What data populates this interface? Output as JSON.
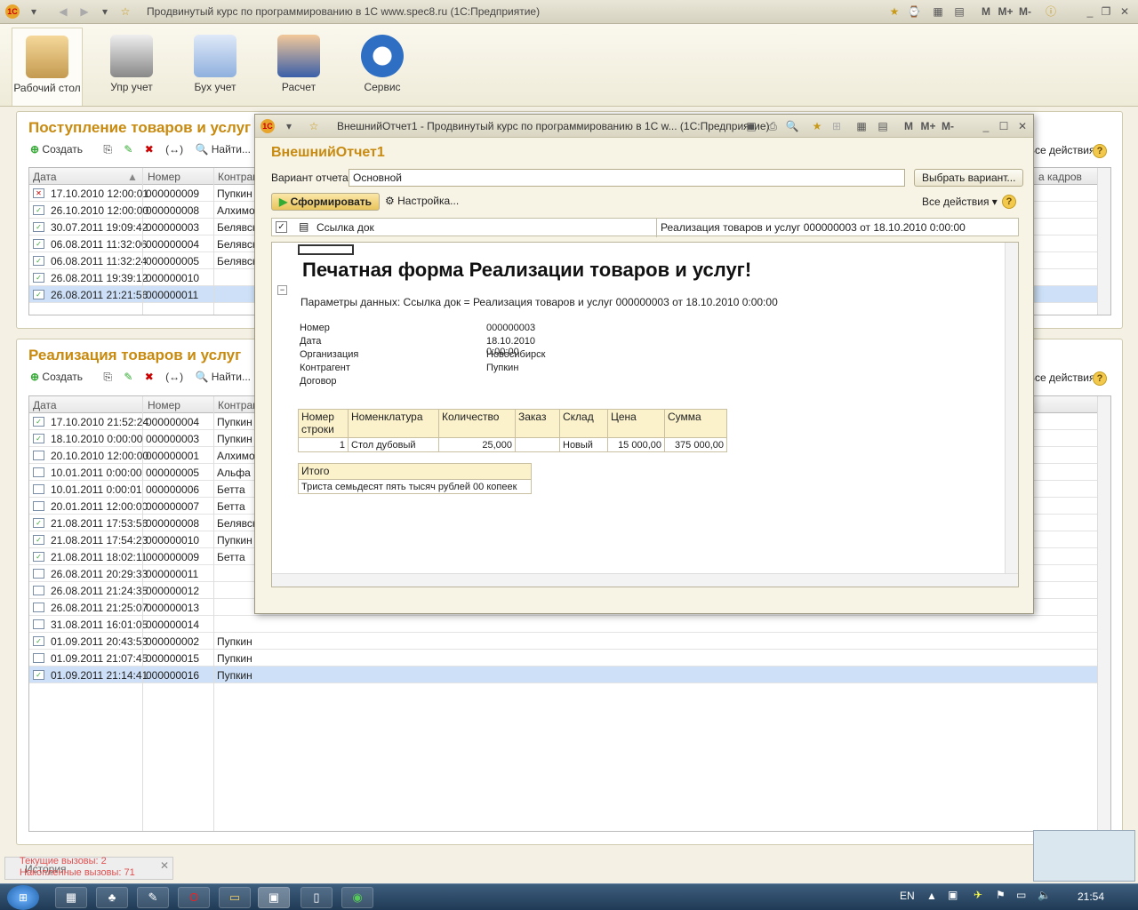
{
  "app": {
    "title": "Продвинутый курс по программированию в 1С www.spec8.ru  (1С:Предприятие)",
    "quick_buttons": [
      "M",
      "M+",
      "M-"
    ]
  },
  "sections": [
    {
      "label": "Рабочий стол"
    },
    {
      "label": "Упр учет"
    },
    {
      "label": "Бух учет"
    },
    {
      "label": "Расчет"
    },
    {
      "label": "Сервис"
    }
  ],
  "receipts": {
    "title": "Поступление товаров и услуг",
    "toolbar": {
      "create": "Создать",
      "find": "Найти...",
      "all_actions": "Все действия",
      "extra_col": "а кадров"
    },
    "columns": [
      "Дата",
      "Номер",
      "Контраг"
    ],
    "rows": [
      {
        "date": "17.10.2010 12:00:01",
        "num": "000000009",
        "agent": "Пупкин",
        "mark": "x"
      },
      {
        "date": "26.10.2010 12:00:00",
        "num": "000000008",
        "agent": "Алхимов",
        "mark": "ok"
      },
      {
        "date": "30.07.2011 19:09:42",
        "num": "000000003",
        "agent": "Белявск",
        "mark": "ok"
      },
      {
        "date": "06.08.2011 11:32:06",
        "num": "000000004",
        "agent": "Белявск",
        "mark": "ok"
      },
      {
        "date": "06.08.2011 11:32:24",
        "num": "000000005",
        "agent": "Белявск",
        "mark": "ok"
      },
      {
        "date": "26.08.2011 19:39:12",
        "num": "000000010",
        "agent": "",
        "mark": "ok"
      },
      {
        "date": "26.08.2011 21:21:56",
        "num": "000000011",
        "agent": "",
        "mark": "ok"
      }
    ]
  },
  "sales": {
    "title": "Реализация товаров и услуг",
    "toolbar": {
      "create": "Создать",
      "find": "Найти...",
      "all_actions": "Все действия"
    },
    "columns": [
      "Дата",
      "Номер",
      "Контраг"
    ],
    "rows": [
      {
        "date": "17.10.2010 21:52:24",
        "num": "000000004",
        "agent": "Пупкин",
        "mark": "ok"
      },
      {
        "date": "18.10.2010 0:00:00",
        "num": "000000003",
        "agent": "Пупкин",
        "mark": "ok"
      },
      {
        "date": "20.10.2010 12:00:00",
        "num": "000000001",
        "agent": "Алхимов",
        "mark": ""
      },
      {
        "date": "10.01.2011 0:00:00",
        "num": "000000005",
        "agent": "Альфа",
        "mark": ""
      },
      {
        "date": "10.01.2011 0:00:01",
        "num": "000000006",
        "agent": "Бетта",
        "mark": ""
      },
      {
        "date": "20.01.2011 12:00:00",
        "num": "000000007",
        "agent": "Бетта",
        "mark": ""
      },
      {
        "date": "21.08.2011 17:53:56",
        "num": "000000008",
        "agent": "Белявск",
        "mark": "ok"
      },
      {
        "date": "21.08.2011 17:54:23",
        "num": "000000010",
        "agent": "Пупкин",
        "mark": "ok"
      },
      {
        "date": "21.08.2011 18:02:11",
        "num": "000000009",
        "agent": "Бетта",
        "mark": "ok"
      },
      {
        "date": "26.08.2011 20:29:33",
        "num": "000000011",
        "agent": "",
        "mark": ""
      },
      {
        "date": "26.08.2011 21:24:35",
        "num": "000000012",
        "agent": "",
        "mark": ""
      },
      {
        "date": "26.08.2011 21:25:07",
        "num": "000000013",
        "agent": "",
        "mark": ""
      },
      {
        "date": "31.08.2011 16:01:05",
        "num": "000000014",
        "agent": "",
        "mark": ""
      },
      {
        "date": "01.09.2011 20:43:53",
        "num": "000000002",
        "agent": "Пупкин",
        "mark": "ok"
      },
      {
        "date": "01.09.2011 21:07:45",
        "num": "000000015",
        "agent": "Пупкин",
        "mark": ""
      },
      {
        "date": "01.09.2011 21:14:41",
        "num": "000000016",
        "agent": "Пупкин",
        "mark": "ok"
      }
    ]
  },
  "dialog": {
    "window_title": "ВнешнийОтчет1 - Продвинутый курс по программированию в 1С w...  (1С:Предприятие)",
    "heading": "ВнешнийОтчет1",
    "variant_label": "Вариант отчета:",
    "variant_value": "Основной",
    "choose_variant": "Выбрать вариант...",
    "generate": "Сформировать",
    "settings": "Настройка...",
    "all_actions": "Все действия",
    "filter_label": "Ссылка док",
    "filter_value": "Реализация товаров и услуг 000000003 от 18.10.2010 0:00:00",
    "report": {
      "title": "Печатная форма Реализации товаров и услуг!",
      "params": "Параметры данных:     Ссылка док = Реализация товаров и услуг 000000003 от 18.10.2010 0:00:00",
      "fields": [
        {
          "label": "Номер",
          "value": "000000003"
        },
        {
          "label": "Дата",
          "value": "18.10.2010 0:00:00"
        },
        {
          "label": "Организация",
          "value": "Новосибирск"
        },
        {
          "label": "Контрагент",
          "value": "Пупкин"
        },
        {
          "label": "Договор",
          "value": ""
        }
      ],
      "table_header": [
        "Номер строки",
        "Номенклатура",
        "Количество",
        "Заказ",
        "Склад",
        "Цена",
        "Сумма"
      ],
      "table_row": [
        "1",
        "Стол дубовый",
        "25,000",
        "",
        "Новый",
        "15 000,00",
        "375 000,00"
      ],
      "total_label": "Итого",
      "total_words": "Триста семьдесят пять тысяч рублей 00 копеек"
    }
  },
  "status": {
    "history": "История",
    "current_calls": "Текущие вызовы: 2",
    "accum_calls": "Накопленные вызовы: 71"
  },
  "taskbar": {
    "lang": "EN",
    "time": "21:54"
  }
}
